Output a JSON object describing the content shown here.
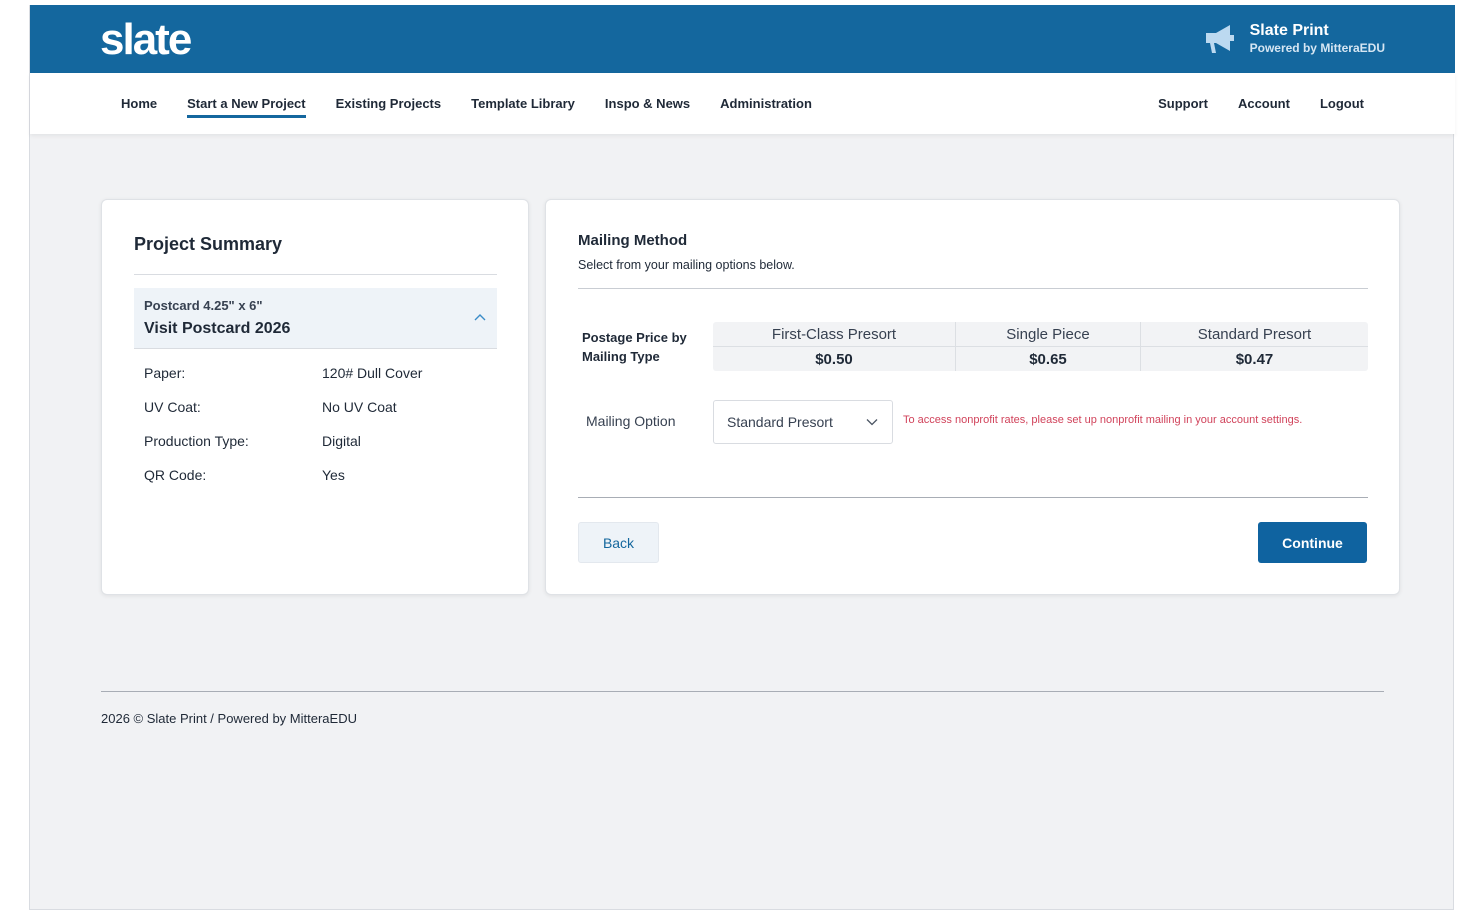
{
  "brand": {
    "logo": "slate",
    "title": "Slate Print",
    "subtitle": "Powered by MitteraEDU",
    "icon": "megaphone-icon"
  },
  "nav": {
    "left": [
      "Home",
      "Start a New Project",
      "Existing Projects",
      "Template Library",
      "Inspo & News",
      "Administration"
    ],
    "active": "Start a New Project",
    "right": [
      "Support",
      "Account",
      "Logout"
    ]
  },
  "summary": {
    "title": "Project Summary",
    "product_size": "Postcard 4.25\" x 6\"",
    "product_name": "Visit Postcard 2026",
    "specs": [
      {
        "label": "Paper:",
        "value": "120# Dull Cover"
      },
      {
        "label": "UV Coat:",
        "value": "No UV Coat"
      },
      {
        "label": "Production Type:",
        "value": "Digital"
      },
      {
        "label": "QR Code:",
        "value": "Yes"
      }
    ]
  },
  "mailing": {
    "title": "Mailing Method",
    "subtitle": "Select from your mailing options below.",
    "price_label": "Postage Price by Mailing Type",
    "prices": [
      {
        "type": "First-Class Presort",
        "price": "$0.50"
      },
      {
        "type": "Single Piece",
        "price": "$0.65"
      },
      {
        "type": "Standard Presort",
        "price": "$0.47"
      }
    ],
    "option_label": "Mailing Option",
    "option_selected": "Standard Presort",
    "notice": "To access nonprofit rates, please set up nonprofit mailing in your account settings.",
    "back_label": "Back",
    "continue_label": "Continue"
  },
  "footer": {
    "text": "2026 © Slate Print / Powered by MitteraEDU"
  },
  "colors": {
    "brand_blue": "#14679e",
    "button_blue": "#0f63a0",
    "notice_red": "#d1435b",
    "background": "#f1f2f4"
  }
}
